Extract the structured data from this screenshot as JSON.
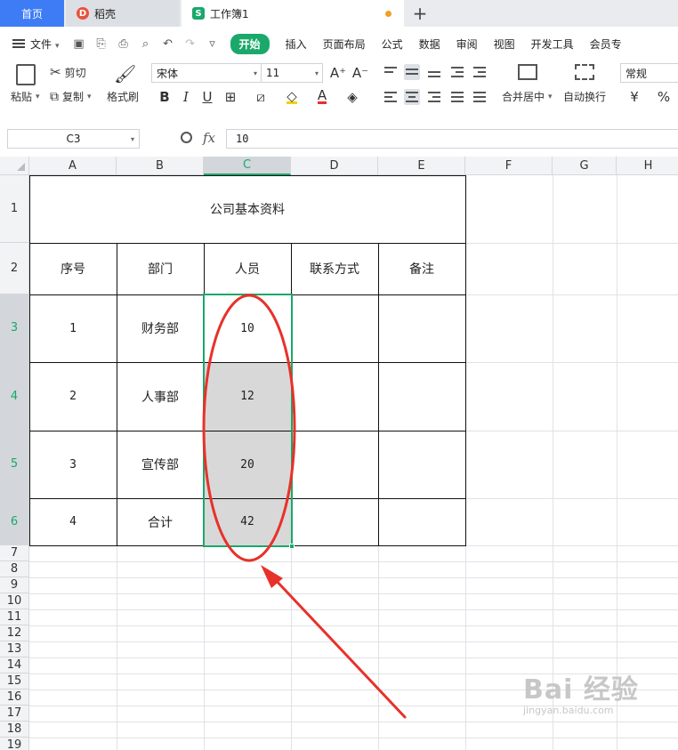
{
  "tabs": {
    "home": "首页",
    "daoke": "稻壳",
    "workbook": "工作簿1",
    "add": "+"
  },
  "menu": {
    "file": "文件",
    "start": "开始",
    "items": [
      "插入",
      "页面布局",
      "公式",
      "数据",
      "审阅",
      "视图",
      "开发工具",
      "会员专"
    ]
  },
  "ribbon": {
    "paste": "粘贴",
    "cut": "剪切",
    "copy": "复制",
    "format_painter": "格式刷",
    "font_name": "宋体",
    "font_size": "11",
    "bold": "B",
    "italic": "I",
    "underline": "U",
    "merge_center": "合并居中",
    "wrap_text": "自动换行",
    "number_format": "常规",
    "currency": "¥",
    "percent": "%",
    "grow_font": "A⁺",
    "shrink_font": "A⁻"
  },
  "formula_bar": {
    "cell_ref": "C3",
    "fx": "fx",
    "value": "10"
  },
  "sheet": {
    "columns": [
      "A",
      "B",
      "C",
      "D",
      "E",
      "F",
      "G",
      "H"
    ],
    "active_column": "C",
    "title": "公司基本资料",
    "headers": [
      "序号",
      "部门",
      "人员",
      "联系方式",
      "备注"
    ],
    "rows": [
      {
        "seq": "1",
        "dept": "财务部",
        "people": "10",
        "contact": "",
        "note": ""
      },
      {
        "seq": "2",
        "dept": "人事部",
        "people": "12",
        "contact": "",
        "note": ""
      },
      {
        "seq": "3",
        "dept": "宣传部",
        "people": "20",
        "contact": "",
        "note": ""
      },
      {
        "seq": "4",
        "dept": "合计",
        "people": "42",
        "contact": "",
        "note": ""
      }
    ],
    "row_numbers": [
      "1",
      "2",
      "3",
      "4",
      "5",
      "6",
      "7",
      "8",
      "9",
      "10",
      "11",
      "12",
      "13",
      "14",
      "15",
      "16",
      "17",
      "18",
      "19"
    ],
    "active_rows": [
      "3",
      "4",
      "5",
      "6"
    ]
  },
  "colors": {
    "accent": "#1aa86b",
    "tab_home": "#3d7cf5",
    "annotation": "#e8312a"
  },
  "watermark": {
    "main": "Bai 经验",
    "sub": "jingyan.baidu.com"
  }
}
